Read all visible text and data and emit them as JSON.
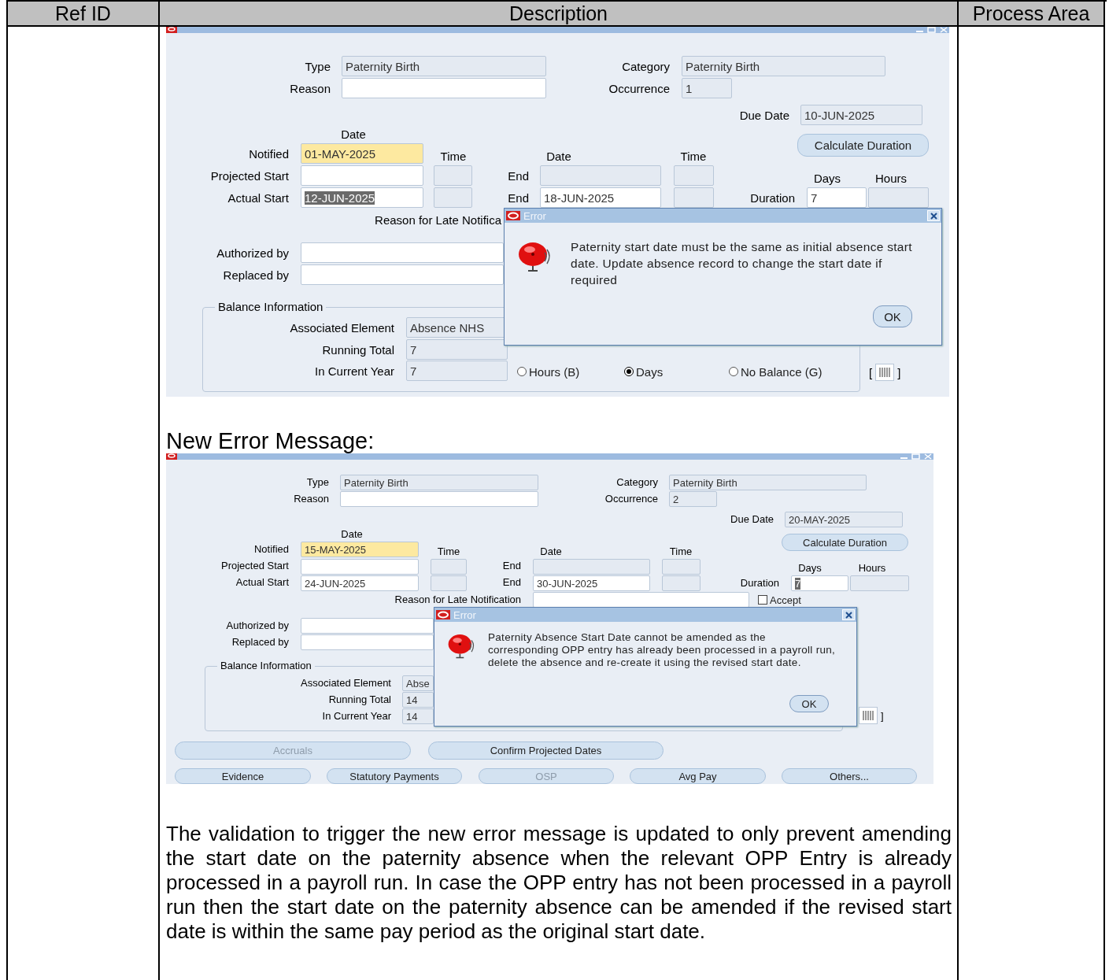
{
  "table": {
    "columns": [
      "Ref ID",
      "Description",
      "Process Area"
    ]
  },
  "screens": [
    {
      "dialog": {
        "title": "Error",
        "message": "Paternity start date must be the same as initial absence start date. Update absence record to change the start date if required",
        "button": "OK"
      },
      "items": [
        {
          "kind": "label",
          "text": "Type"
        },
        {
          "kind": "locked",
          "value": "Paternity Birth"
        },
        {
          "kind": "label",
          "text": "Category"
        },
        {
          "kind": "locked",
          "value": "Paternity Birth"
        },
        {
          "kind": "label",
          "text": "Reason"
        },
        {
          "kind": "input",
          "value": ""
        },
        {
          "kind": "label",
          "text": "Occurrence"
        },
        {
          "kind": "locked",
          "value": "1"
        },
        {
          "kind": "label",
          "text": "Due Date"
        },
        {
          "kind": "locked",
          "value": "10-JUN-2025"
        },
        {
          "kind": "heading",
          "text": "Date"
        },
        {
          "kind": "button",
          "text": "Calculate Duration",
          "disabled": false
        },
        {
          "kind": "label",
          "text": "Notified"
        },
        {
          "kind": "required",
          "value": "01-MAY-2025"
        },
        {
          "kind": "heading",
          "text": "Time"
        },
        {
          "kind": "heading",
          "text": "Date"
        },
        {
          "kind": "heading",
          "text": "Time"
        },
        {
          "kind": "label",
          "text": "Projected Start"
        },
        {
          "kind": "input",
          "value": ""
        },
        {
          "kind": "locked",
          "value": ""
        },
        {
          "kind": "label",
          "text": "End"
        },
        {
          "kind": "locked",
          "value": ""
        },
        {
          "kind": "locked",
          "value": ""
        },
        {
          "kind": "heading",
          "text": "Days"
        },
        {
          "kind": "heading",
          "text": "Hours"
        },
        {
          "kind": "label",
          "text": "Actual Start"
        },
        {
          "kind": "input",
          "value": "12-JUN-2025",
          "selected": true
        },
        {
          "kind": "locked",
          "value": ""
        },
        {
          "kind": "label",
          "text": "End"
        },
        {
          "kind": "input",
          "value": "18-JUN-2025"
        },
        {
          "kind": "locked",
          "value": ""
        },
        {
          "kind": "label",
          "text": "Duration"
        },
        {
          "kind": "input",
          "value": "7"
        },
        {
          "kind": "locked",
          "value": ""
        },
        {
          "kind": "label",
          "text": "Reason for Late Notifica"
        },
        {
          "kind": "label",
          "text": "Authorized by"
        },
        {
          "kind": "input",
          "value": ""
        },
        {
          "kind": "label",
          "text": "Replaced by"
        },
        {
          "kind": "input",
          "value": ""
        },
        {
          "kind": "group",
          "text": "Balance Information"
        },
        {
          "kind": "label",
          "text": "Associated Element"
        },
        {
          "kind": "locked",
          "value": "Absence NHS"
        },
        {
          "kind": "label",
          "text": "Running Total"
        },
        {
          "kind": "locked",
          "value": "7"
        },
        {
          "kind": "label",
          "text": "In Current Year"
        },
        {
          "kind": "locked",
          "value": "7"
        },
        {
          "kind": "radio",
          "text": "Hours (B)",
          "selected": false
        },
        {
          "kind": "radio",
          "text": "Days",
          "selected": true
        },
        {
          "kind": "radio",
          "text": "No Balance (G)",
          "selected": false
        },
        {
          "kind": "flex",
          "open": "[",
          "close": "]"
        }
      ]
    },
    {
      "dialog": {
        "title": "Error",
        "message": "Paternity Absence Start Date cannot be amended as the corresponding OPP entry has already been processed in a payroll run, delete the absence and re-create it using the revised start date.",
        "button": "OK"
      },
      "items": [
        {
          "kind": "label",
          "text": "Type"
        },
        {
          "kind": "locked",
          "value": "Paternity Birth"
        },
        {
          "kind": "label",
          "text": "Category"
        },
        {
          "kind": "locked",
          "value": "Paternity Birth"
        },
        {
          "kind": "label",
          "text": "Reason"
        },
        {
          "kind": "input",
          "value": ""
        },
        {
          "kind": "label",
          "text": "Occurrence"
        },
        {
          "kind": "locked",
          "value": "2"
        },
        {
          "kind": "label",
          "text": "Due Date"
        },
        {
          "kind": "locked",
          "value": "20-MAY-2025"
        },
        {
          "kind": "heading",
          "text": "Date"
        },
        {
          "kind": "button",
          "text": "Calculate Duration",
          "disabled": false
        },
        {
          "kind": "label",
          "text": "Notified"
        },
        {
          "kind": "required",
          "value": "15-MAY-2025"
        },
        {
          "kind": "heading",
          "text": "Time"
        },
        {
          "kind": "heading",
          "text": "Date"
        },
        {
          "kind": "heading",
          "text": "Time"
        },
        {
          "kind": "label",
          "text": "Projected Start"
        },
        {
          "kind": "input",
          "value": ""
        },
        {
          "kind": "locked",
          "value": ""
        },
        {
          "kind": "label",
          "text": "End"
        },
        {
          "kind": "locked",
          "value": ""
        },
        {
          "kind": "locked",
          "value": ""
        },
        {
          "kind": "heading",
          "text": "Days"
        },
        {
          "kind": "heading",
          "text": "Hours"
        },
        {
          "kind": "label",
          "text": "Actual Start"
        },
        {
          "kind": "input",
          "value": "24-JUN-2025"
        },
        {
          "kind": "locked",
          "value": ""
        },
        {
          "kind": "label",
          "text": "End"
        },
        {
          "kind": "input",
          "value": "30-JUN-2025"
        },
        {
          "kind": "locked",
          "value": ""
        },
        {
          "kind": "label",
          "text": "Duration"
        },
        {
          "kind": "input",
          "value": "7",
          "selected": true
        },
        {
          "kind": "locked",
          "value": ""
        },
        {
          "kind": "label",
          "text": "Reason for Late Notification"
        },
        {
          "kind": "input",
          "value": ""
        },
        {
          "kind": "checkbox",
          "text": "Accept",
          "checked": false
        },
        {
          "kind": "label",
          "text": "Authorized by"
        },
        {
          "kind": "input",
          "value": ""
        },
        {
          "kind": "label",
          "text": "Replaced by"
        },
        {
          "kind": "input",
          "value": ""
        },
        {
          "kind": "group",
          "text": "Balance Information"
        },
        {
          "kind": "label",
          "text": "Associated Element"
        },
        {
          "kind": "locked",
          "value": "Abse"
        },
        {
          "kind": "label",
          "text": "Running Total"
        },
        {
          "kind": "locked",
          "value": "14"
        },
        {
          "kind": "label",
          "text": "In Current Year"
        },
        {
          "kind": "locked",
          "value": "14"
        },
        {
          "kind": "flex",
          "close": "]"
        },
        {
          "kind": "button",
          "text": "Accruals",
          "disabled": true
        },
        {
          "kind": "button",
          "text": "Confirm Projected Dates",
          "disabled": false
        },
        {
          "kind": "button",
          "text": "Evidence",
          "disabled": false
        },
        {
          "kind": "button",
          "text": "Statutory Payments",
          "disabled": false
        },
        {
          "kind": "button",
          "text": "OSP",
          "disabled": true
        },
        {
          "kind": "button",
          "text": "Avg Pay",
          "disabled": false
        },
        {
          "kind": "button",
          "text": "Others...",
          "disabled": false
        }
      ]
    }
  ],
  "caption": "New Error Message:",
  "paragraph": "The validation to trigger the new error message is updated to only prevent amending the start date on the paternity absence when the relevant OPP Entry is already processed in a payroll run. In case the OPP entry has not been processed in a payroll run then the start date on the paternity absence can be amended if the revised start date is within the same pay period as the original start date."
}
